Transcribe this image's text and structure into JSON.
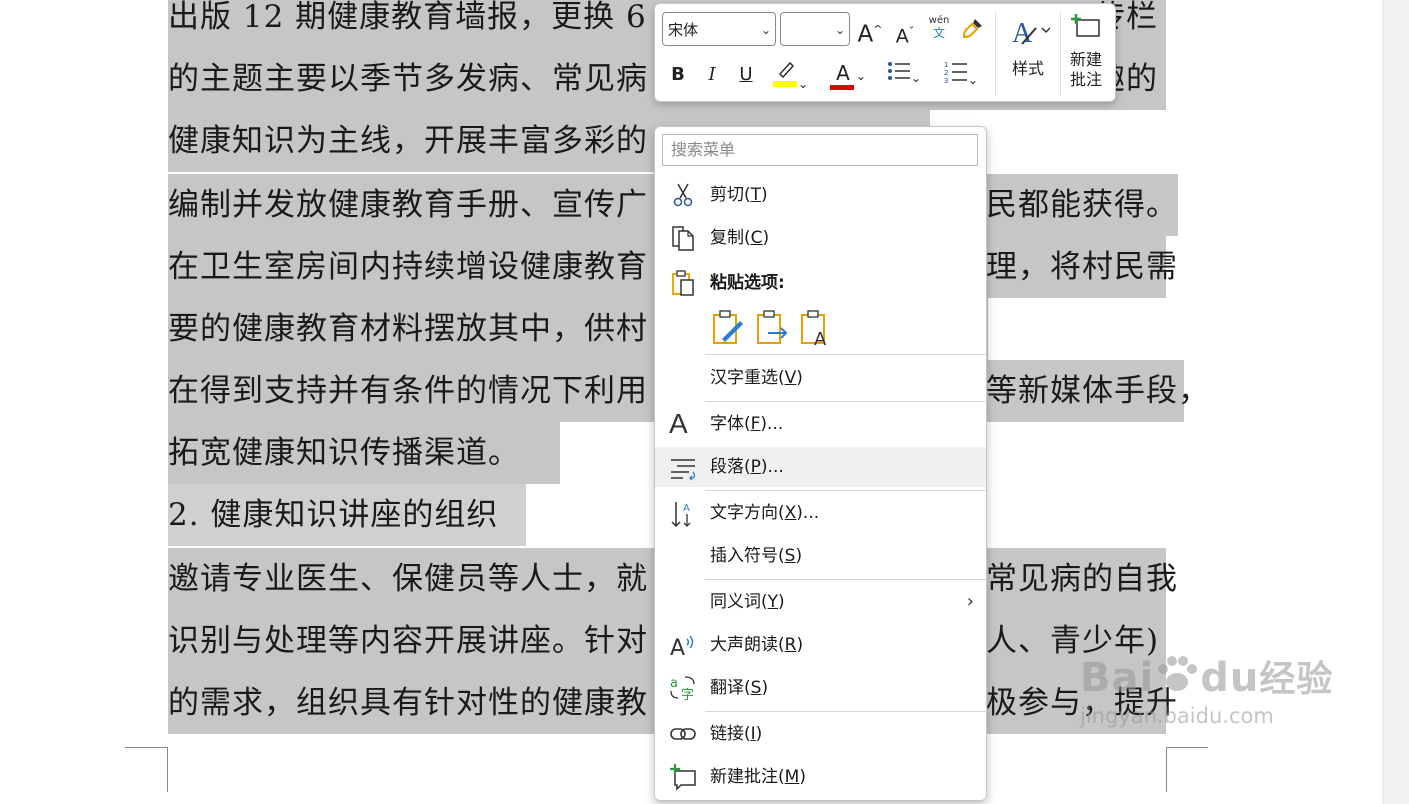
{
  "document": {
    "lines": [
      {
        "text": "出版 12 期健康教育墙报，更换 6"
      },
      {
        "text": "的主题主要以季节多发病、常见病"
      },
      {
        "text": "健康知识为主线，开展丰富多彩的"
      },
      {
        "text": "编制并发放健康教育手册、宣传广"
      },
      {
        "text": "在卫生室房间内持续增设健康教育"
      },
      {
        "text": "要的健康教育材料摆放其中，供村"
      },
      {
        "text": "在得到支持并有条件的情况下利用"
      },
      {
        "text": "拓宽健康知识传播渠道。"
      },
      {
        "text": "2. 健康知识讲座的组织"
      },
      {
        "text": "邀请专业医生、保健员等人士，就"
      },
      {
        "text": "识别与处理等内容开展讲座。针对"
      },
      {
        "text": "的需求，组织具有针对性的健康教"
      }
    ],
    "right_fragments": [
      {
        "text": "传栏"
      },
      {
        "text": "趣的"
      },
      {
        "text": "民都能获得。"
      },
      {
        "text": "理，将村民需"
      },
      {
        "text": "等新媒体手段，"
      },
      {
        "text": "常见病的自我"
      },
      {
        "text": "人、青少年)"
      },
      {
        "text": "极参与，提升"
      }
    ]
  },
  "mini_toolbar": {
    "font_name": "宋体",
    "font_size": "",
    "grow_font": "A",
    "shrink_font": "A",
    "phonetic_top": "wén",
    "phonetic_bottom": "文",
    "bold": "B",
    "italic": "I",
    "underline": "U",
    "font_color_letter": "A",
    "styles_label": "样式",
    "new_comment_line1": "新建",
    "new_comment_line2": "批注",
    "highlight_color": "#ffff00",
    "font_color": "#e00000"
  },
  "context_menu": {
    "search_placeholder": "搜索菜单",
    "cut": {
      "text": "剪切(",
      "key": "T",
      "end": ")"
    },
    "copy": {
      "text": "复制(",
      "key": "C",
      "end": ")"
    },
    "paste_options_label": "粘贴选项:",
    "reconvert": {
      "text": "汉字重选(",
      "key": "V",
      "end": ")"
    },
    "font": {
      "text": "字体(",
      "key": "F",
      "end": ")..."
    },
    "paragraph": {
      "text": "段落(",
      "key": "P",
      "end": ")..."
    },
    "text_direction": {
      "text": "文字方向(",
      "key": "X",
      "end": ")..."
    },
    "insert_symbol": {
      "text": "插入符号(",
      "key": "S",
      "end": ")"
    },
    "synonyms": {
      "text": "同义词(",
      "key": "Y",
      "end": ")"
    },
    "read_aloud": {
      "text": "大声朗读(",
      "key": "R",
      "end": ")"
    },
    "translate": {
      "text": "翻译(",
      "key": "S",
      "end": ")"
    },
    "link": {
      "text": "链接(",
      "key": "I",
      "end": ")"
    },
    "new_comment": {
      "text": "新建批注(",
      "key": "M",
      "end": ")"
    }
  },
  "watermark": {
    "brand": "Bai",
    "brand2": "du",
    "cn": "经验",
    "url": "jingyan.baidu.com"
  }
}
